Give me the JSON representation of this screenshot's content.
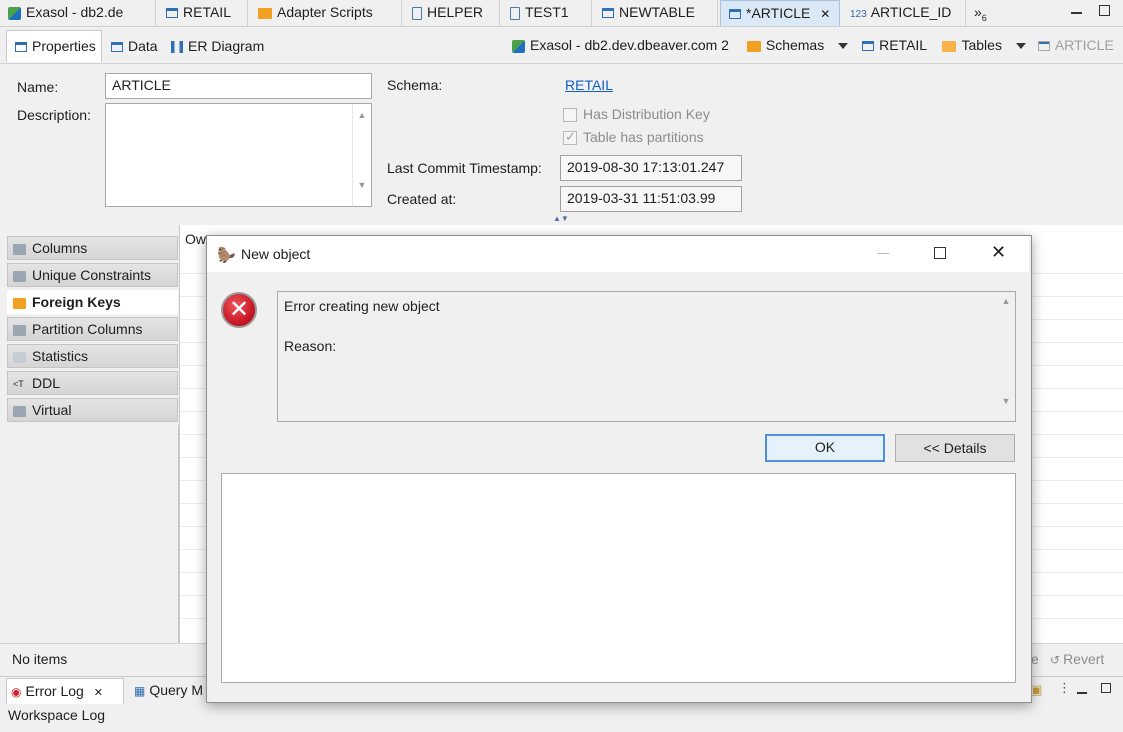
{
  "editor_tabs": [
    {
      "label": "Exasol - db2.de",
      "icon": "exasol-db-icon"
    },
    {
      "label": "RETAIL",
      "icon": "schema-icon"
    },
    {
      "label": "Adapter Scripts",
      "icon": "folder-icon"
    },
    {
      "label": "HELPER",
      "icon": "script-icon"
    },
    {
      "label": "TEST1",
      "icon": "script-icon"
    },
    {
      "label": "NEWTABLE",
      "icon": "table-icon"
    },
    {
      "label": "*ARTICLE",
      "icon": "table-icon",
      "active": true
    },
    {
      "label": "ARTICLE_ID",
      "icon": "sequence-icon",
      "icon_text": "123"
    }
  ],
  "overflow_tabs": {
    "count": "6"
  },
  "sub_tabs": [
    {
      "label": "Properties",
      "active": true
    },
    {
      "label": "Data"
    },
    {
      "label": "ER Diagram"
    }
  ],
  "breadcrumb": {
    "connection": "Exasol - db2.dev.dbeaver.com 2",
    "schemas": "Schemas",
    "schema": "RETAIL",
    "tables": "Tables",
    "table": "ARTICLE"
  },
  "properties": {
    "name_label": "Name:",
    "name_value": "ARTICLE",
    "description_label": "Description:",
    "schema_label": "Schema:",
    "schema_value": "RETAIL",
    "has_distribution_key": "Has Distribution Key",
    "table_has_partitions": "Table has partitions",
    "last_commit_label": "Last Commit Timestamp:",
    "last_commit_value": "2019-08-30 17:13:01.247",
    "created_label": "Created at:",
    "created_value": "2019-03-31 11:51:03.99"
  },
  "side_tabs": [
    {
      "label": "Columns"
    },
    {
      "label": "Unique Constraints"
    },
    {
      "label": "Foreign Keys",
      "active": true
    },
    {
      "label": "Partition Columns"
    },
    {
      "label": "Statistics"
    },
    {
      "label": "DDL"
    },
    {
      "label": "Virtual"
    }
  ],
  "grid": {
    "first_header": "Ow"
  },
  "status": {
    "items": "No items",
    "save_fragment": "e",
    "revert": "Revert"
  },
  "bottom_tabs": [
    {
      "label": "Error Log"
    },
    {
      "label": "Query M"
    }
  ],
  "workspace_log": "Workspace Log",
  "dialog": {
    "title": "New object",
    "message_line1": "Error creating new object",
    "message_line2": "Reason:",
    "ok": "OK",
    "details": "<< Details"
  },
  "colors": {
    "accent": "#4f8fdc",
    "link": "#0f5fc0",
    "error": "#d11f2b",
    "folder": "#f2a022"
  }
}
